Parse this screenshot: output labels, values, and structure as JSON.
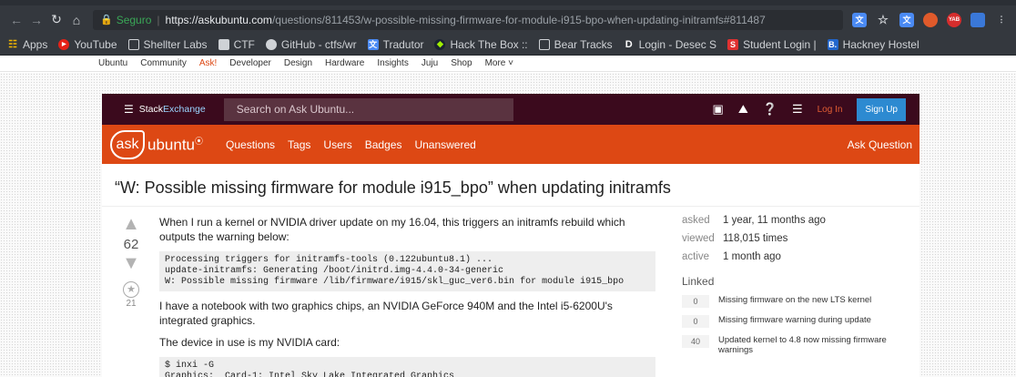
{
  "browser": {
    "secure_label": "Seguro",
    "url_host": "https://askubuntu.com",
    "url_rest": "/questions/811453/w-possible-missing-firmware-for-module-i915-bpo-when-updating-initramfs#811487",
    "bookmarks": [
      {
        "label": "Apps",
        "icon": "apps-grid-icon",
        "color": "#f2b600"
      },
      {
        "label": "YouTube",
        "icon": "youtube-icon",
        "color": "#e62117"
      },
      {
        "label": "Shellter Labs",
        "icon": "page-icon",
        "color": "#cfd2d6"
      },
      {
        "label": "CTF",
        "icon": "folder-icon",
        "color": "#cfd2d6"
      },
      {
        "label": "GitHub - ctfs/wr",
        "icon": "github-icon",
        "color": "#cfd2d6"
      },
      {
        "label": "Tradutor",
        "icon": "translate-icon",
        "color": "#4a8af4"
      },
      {
        "label": "Hack The Box ::",
        "icon": "htb-icon",
        "color": "#9fef00"
      },
      {
        "label": "Bear Tracks",
        "icon": "page-icon",
        "color": "#cfd2d6"
      },
      {
        "label": "Login - Desec S",
        "icon": "d-icon",
        "color": "#ffffff"
      },
      {
        "label": "Student Login |",
        "icon": "s-icon",
        "color": "#e03131"
      },
      {
        "label": "Hackney Hostel",
        "icon": "b-icon",
        "color": "#2266cc"
      }
    ]
  },
  "ubuntu_bar": {
    "items": [
      "Ubuntu",
      "Community",
      "Ask!",
      "Developer",
      "Design",
      "Hardware",
      "Insights",
      "Juju",
      "Shop",
      "More ˅"
    ]
  },
  "se_bar": {
    "logo_stack": "Stack",
    "logo_exchange": "Exchange",
    "search_placeholder": "Search on Ask Ubuntu...",
    "login": "Log In",
    "signup": "Sign Up"
  },
  "au_bar": {
    "logo_ask": "ask",
    "logo_ubuntu": "ubuntu",
    "nav": [
      "Questions",
      "Tags",
      "Users",
      "Badges",
      "Unanswered"
    ],
    "ask_question": "Ask Question"
  },
  "question": {
    "title": "“W: Possible missing firmware for module i915_bpo” when updating initramfs",
    "votes": "62",
    "favorites": "21",
    "p1": "When I run a kernel or NVIDIA driver update on my 16.04, this triggers an initramfs rebuild which outputs the warning below:",
    "code1": "Processing triggers for initramfs-tools (0.122ubuntu8.1) ...\nupdate-initramfs: Generating /boot/initrd.img-4.4.0-34-generic\nW: Possible missing firmware /lib/firmware/i915/skl_guc_ver6.bin for module i915_bpo",
    "p2": "I have a notebook with two graphics chips, an NVIDIA GeForce 940M and the Intel i5-6200U's integrated graphics.",
    "p3": "The device in use is my NVIDIA card:",
    "code2": "$ inxi -G\nGraphics:  Card-1: Intel Sky Lake Integrated Graphics"
  },
  "sidebar": {
    "asked_k": "asked",
    "asked_v": "1 year, 11 months ago",
    "viewed_k": "viewed",
    "viewed_v": "118,015 times",
    "active_k": "active",
    "active_v": "1 month ago",
    "linked_heading": "Linked",
    "linked": [
      {
        "count": "0",
        "title": "Missing firmware on the new LTS kernel"
      },
      {
        "count": "0",
        "title": "Missing firmware warning during update"
      },
      {
        "count": "40",
        "title": "Updated kernel to 4.8 now missing firmware warnings"
      }
    ]
  },
  "colors": {
    "ubuntu_orange": "#dd4814",
    "se_bar": "#3b0a1d",
    "signup_blue": "#2d8ad1"
  }
}
